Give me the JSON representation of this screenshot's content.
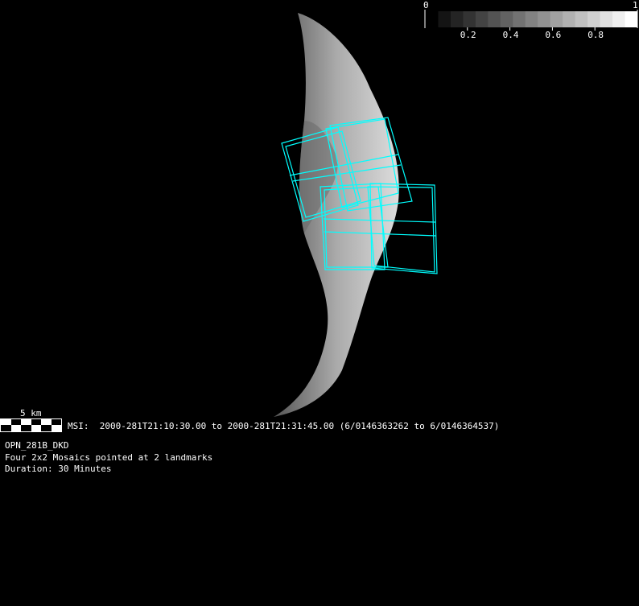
{
  "colorbar": {
    "min_label": "0",
    "max_label": "1",
    "ticks": [
      "0.2",
      "0.4",
      "0.6",
      "0.8"
    ],
    "tick_values": [
      0.2,
      0.4,
      0.6,
      0.8
    ]
  },
  "scale_bar": {
    "label": "5 km"
  },
  "msi_line": "MSI:  2000-281T21:10:30.00 to 2000-281T21:31:45.00 (6/0146363262 to 6/0146364537)",
  "info": {
    "sequence_name": "OPN_281B_DKD",
    "description": "Four 2x2 Mosaics pointed at 2 landmarks",
    "duration": "Duration: 30 Minutes"
  },
  "colors": {
    "footprint": "#00ffff",
    "background": "#000000"
  }
}
